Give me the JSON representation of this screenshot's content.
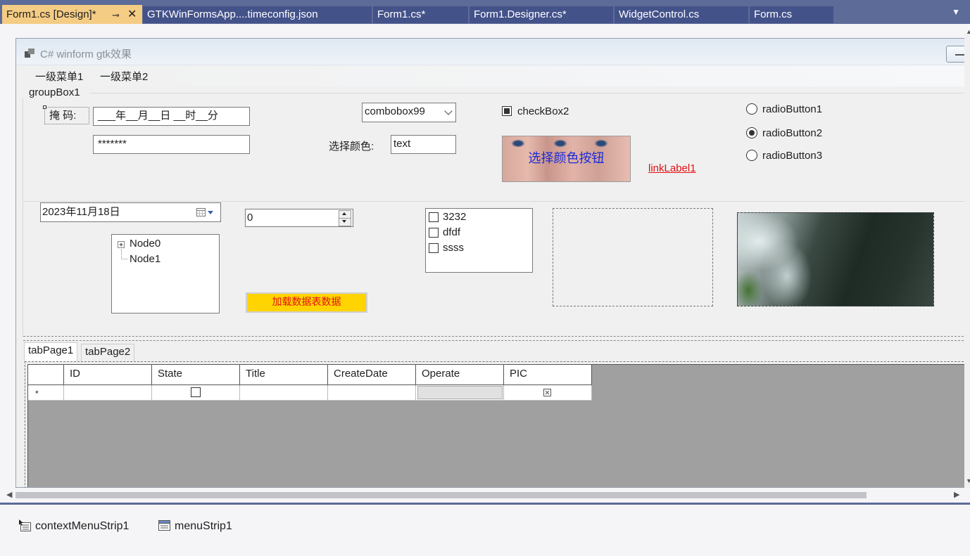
{
  "tabs": [
    {
      "label": "Form1.cs [Design]*",
      "active": true
    },
    {
      "label": "GTKWinFormsApp....timeconfig.json"
    },
    {
      "label": "Form1.cs*"
    },
    {
      "label": "Form1.Designer.cs*"
    },
    {
      "label": "WidgetControl.cs"
    },
    {
      "label": "Form.cs"
    }
  ],
  "form": {
    "title": "C# winform gtk效果",
    "menu": [
      "一级菜单1",
      "一级菜单2"
    ],
    "groupbox_title": "groupBox1",
    "mask_label": "掩 码:",
    "masked_value": "___年__月__日 __时__分",
    "password_value": "*******",
    "combobox_value": "combobox99",
    "color_label": "选择颜色:",
    "text_value": "text",
    "checkbox_label": "checkBox2",
    "checkbox_checked": true,
    "color_button_label": "选择颜色按钮",
    "link_label": "linkLabel1",
    "radios": [
      {
        "label": "radioButton1",
        "checked": false
      },
      {
        "label": "radioButton2",
        "checked": true
      },
      {
        "label": "radioButton3",
        "checked": false
      }
    ],
    "date_value": "2023年11月18日",
    "numeric_value": "0",
    "checklist": [
      "3232",
      "dfdf",
      "ssss"
    ],
    "tree_nodes": [
      "Node0",
      "Node1"
    ],
    "load_button_label": "加载数据表数据",
    "tab_pages": [
      "tabPage1",
      "tabPage2"
    ],
    "grid_columns": [
      "ID",
      "State",
      "Title",
      "CreateDate",
      "Operate",
      "PIC"
    ],
    "grid_new_row_marker": "*"
  },
  "tray": [
    "contextMenuStrip1",
    "menuStrip1"
  ],
  "colors": {
    "tab_strip": "#5d6b99",
    "active_tab": "#f5cc84",
    "inactive_tab": "#44528a",
    "load_button_bg": "#ffd400",
    "load_button_text": "#e01010",
    "link": "#e01010",
    "color_button_text": "#1a2ad8",
    "grid_background": "#a0a0a0"
  }
}
